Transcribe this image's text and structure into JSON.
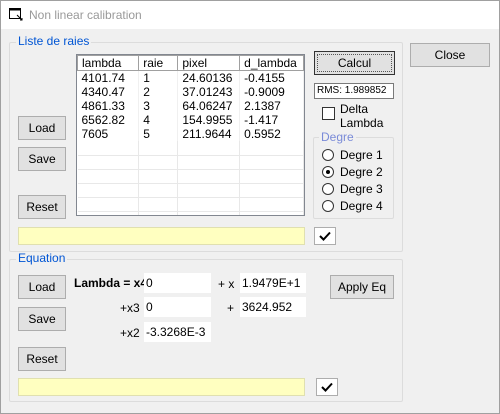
{
  "window": {
    "title": "Non linear calibration"
  },
  "close_label": "Close",
  "raies": {
    "group_label": "Liste de raies",
    "columns": [
      "lambda",
      "raie",
      "pixel",
      "d_lambda"
    ],
    "rows": [
      [
        "4101.74",
        "1",
        "24.60136",
        "-0.4155"
      ],
      [
        "4340.47",
        "2",
        "37.01243",
        "-0.9009"
      ],
      [
        "4861.33",
        "3",
        "64.06247",
        "2.1387"
      ],
      [
        "6562.82",
        "4",
        "154.9955",
        "-1.417"
      ],
      [
        "7605",
        "5",
        "211.9644",
        "0.5952"
      ]
    ],
    "load_label": "Load",
    "save_label": "Save",
    "reset_label": "Reset",
    "calcul_label": "Calcul",
    "rms_text": "RMS:  1.989852",
    "delta_lambda_label_1": "Delta",
    "delta_lambda_label_2": "Lambda",
    "degre_group_label": "Degre",
    "degre_options": [
      "Degre 1",
      "Degre 2",
      "Degre 3",
      "Degre 4"
    ],
    "degre_selected": "Degre 2",
    "status_text": ""
  },
  "equation": {
    "group_label": "Equation",
    "load_label": "Load",
    "save_label": "Save",
    "reset_label": "Reset",
    "lambda_label": "Lambda = x4",
    "x3_label": "+x3",
    "x2_label": "+x2",
    "x_label": "+ x",
    "plus_label": "+",
    "coef_x4": "0",
    "coef_x3": "0",
    "coef_x2": "-3.3268E-3",
    "coef_x": "1.9479E+1",
    "coef_const": "3624.952",
    "apply_label": "Apply Eq",
    "status_text": ""
  },
  "colors": {
    "group_label": "#0055d4",
    "status_bg": "#ffffc0",
    "title_text": "#999999"
  }
}
